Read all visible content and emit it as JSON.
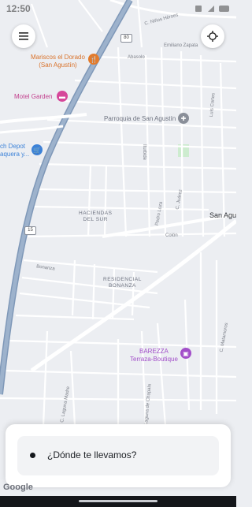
{
  "status_bar": {
    "time": "12:50"
  },
  "map": {
    "labels": {
      "mariscos": "Mariscos el Dorado\n(San Agustín)",
      "motel": "Motel Garden",
      "depot": "ch Depot\naquera y...",
      "parroquia": "Parroquia de San Agustín",
      "haciendas": "HACIENDAS\nDEL SUR",
      "residencial": "RESIDENCIAL\nBONANZA",
      "barezza": "BAREZZA\nTerraza-Boutique",
      "city": "San Agu",
      "c_ninos": "C. Niños Héroes",
      "zapata": "Emiliano Zapata",
      "abasolo": "Abasolo",
      "iturbide": "Iturbide",
      "pedro_loza": "Pedro Loza",
      "c_juarez": "C. Juárez",
      "luis_cortes": "Luis Cortes",
      "colon": "Colón",
      "bonanza": "Bonanza",
      "laguna": "C. Laguna Madre",
      "chapala": "Laguna de Chapala",
      "matamoros": "C. Matamoros",
      "hw80": "80",
      "hw15": "15"
    }
  },
  "buttons": {
    "menu_icon": "menu-icon",
    "locate_icon": "locate-icon"
  },
  "sheet": {
    "placeholder": "¿Dónde te llevamos?"
  },
  "attribution": "Google",
  "colors": {
    "highway": "#8fa6c2",
    "road": "#ffffff",
    "background": "#eceef2"
  }
}
